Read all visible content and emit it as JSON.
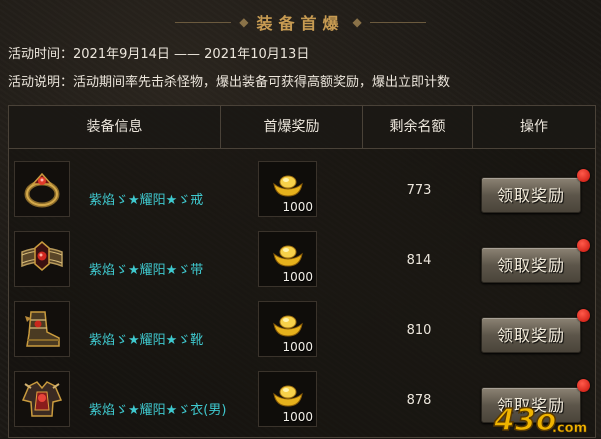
{
  "header": {
    "title": "装备首爆",
    "ornament": "◆"
  },
  "info": {
    "time_line": "活动时间：2021年9月14日 —— 2021年10月13日",
    "desc_line": "活动说明：活动期间率先击杀怪物，爆出装备可获得高额奖励，爆出立即计数"
  },
  "table": {
    "headers": [
      "装备信息",
      "首爆奖励",
      "剩余名额",
      "操作"
    ],
    "rows": [
      {
        "item_name": "紫焰ゞ★耀阳★ゞ戒",
        "item_icon": "ring-icon",
        "reward_icon": "gold-ingot-icon",
        "reward_count": "1000",
        "remaining": "773",
        "button": "领取奖励"
      },
      {
        "item_name": "紫焰ゞ★耀阳★ゞ带",
        "item_icon": "belt-icon",
        "reward_icon": "gold-ingot-icon",
        "reward_count": "1000",
        "remaining": "814",
        "button": "领取奖励"
      },
      {
        "item_name": "紫焰ゞ★耀阳★ゞ靴",
        "item_icon": "boots-icon",
        "reward_icon": "gold-ingot-icon",
        "reward_count": "1000",
        "remaining": "810",
        "button": "领取奖励"
      },
      {
        "item_name": "紫焰ゞ★耀阳★ゞ衣(男)",
        "item_icon": "armor-icon",
        "reward_icon": "gold-ingot-icon",
        "reward_count": "1000",
        "remaining": "878",
        "button": "领取奖励"
      }
    ]
  },
  "watermark": {
    "text": "43o",
    "suffix": ".com"
  },
  "colors": {
    "title": "#c79b52",
    "item_name": "#3fc9cf",
    "notification_dot": "#e0281c",
    "watermark": "#f0b400"
  }
}
